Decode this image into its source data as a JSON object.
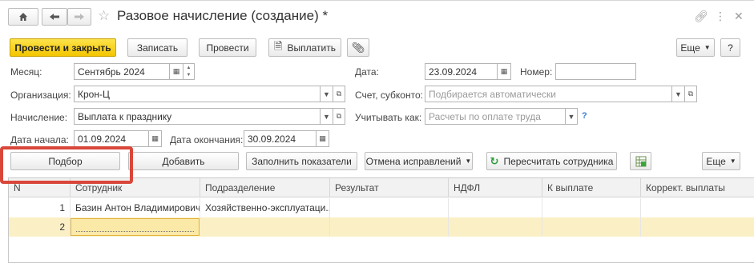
{
  "window": {
    "title": "Разовое начисление (создание) *",
    "icons": [
      "home-icon",
      "back-arrow-icon",
      "forward-arrow-icon",
      "favorite-star-icon",
      "link-icon",
      "more-icon",
      "close-icon"
    ]
  },
  "toolbar": {
    "post_close": "Провести и закрыть",
    "save": "Записать",
    "post": "Провести",
    "pay": "Выплатить",
    "more": "Еще",
    "help": "?"
  },
  "form": {
    "month_label": "Месяц:",
    "month_value": "Сентябрь 2024",
    "date_label": "Дата:",
    "date_value": "23.09.2024",
    "number_label": "Номер:",
    "number_value": "",
    "org_label": "Организация:",
    "org_value": "Крон-Ц",
    "account_label": "Счет, субконто:",
    "account_placeholder": "Подбирается автоматически",
    "accrual_label": "Начисление:",
    "accrual_value": "Выплата к празднику",
    "consider_label": "Учитывать как:",
    "consider_placeholder": "Расчеты по оплате труда",
    "consider_help": "?",
    "start_label": "Дата начала:",
    "start_value": "01.09.2024",
    "end_label": "Дата окончания:",
    "end_value": "30.09.2024"
  },
  "table_toolbar": {
    "pick": "Подбор",
    "add": "Добавить",
    "fill": "Заполнить показатели",
    "cancel_fix": "Отмена исправлений",
    "recalc": "Пересчитать сотрудника",
    "more": "Еще"
  },
  "table": {
    "columns": [
      "N",
      "Сотрудник",
      "Подразделение",
      "Результат",
      "НДФЛ",
      "К выплате",
      "Коррект. выплаты"
    ],
    "rows": [
      [
        "1",
        "Базин Антон Владимирович",
        "Хозяйственно-эксплуатаци...",
        "",
        "",
        "",
        ""
      ],
      [
        "2",
        "",
        "",
        "",
        "",
        "",
        ""
      ]
    ]
  },
  "colors": {
    "primary_button": "#f3c600",
    "highlight_frame": "#d9473a",
    "selected_row": "#fbefc5",
    "help_blue": "#3a7bd5"
  }
}
